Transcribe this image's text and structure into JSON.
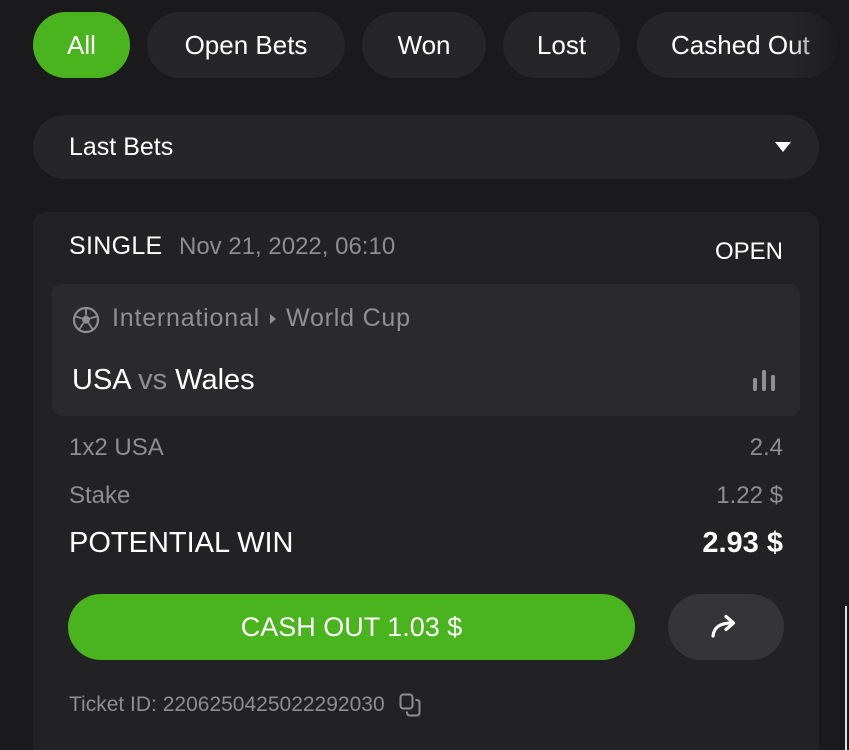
{
  "filters": {
    "all": "All",
    "open": "Open Bets",
    "won": "Won",
    "lost": "Lost",
    "cashed_out": "Cashed Out"
  },
  "dropdown": {
    "selected": "Last Bets"
  },
  "bet": {
    "type": "SINGLE",
    "date": "Nov 21, 2022, 06:10",
    "status": "OPEN",
    "event": {
      "sport_icon": "soccer-ball-icon",
      "league_country": "International",
      "league_name": "World Cup",
      "home": "USA",
      "vs": "vs",
      "away": "Wales"
    },
    "market_label": "1x2 USA",
    "odds": "2.4",
    "stake_label": "Stake",
    "stake_value": "1.22 $",
    "potential_label": "POTENTIAL WIN",
    "potential_value": "2.93 $",
    "cashout_label": "CASH OUT 1.03 $",
    "ticket_id": "Ticket ID: 2206250425022292030"
  },
  "colors": {
    "background": "#1a1a1c",
    "surface": "#262629",
    "accent": "#4ab41f",
    "muted_text": "#8d8d92"
  }
}
